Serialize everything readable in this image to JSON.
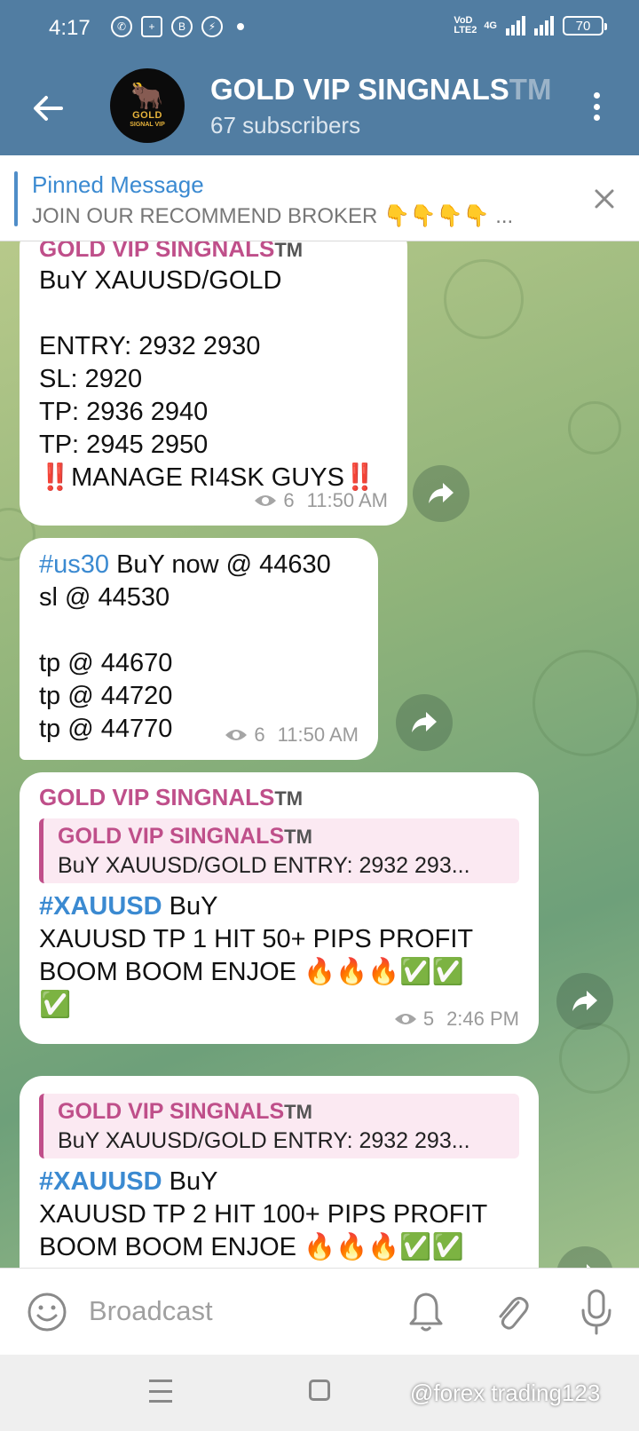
{
  "status": {
    "time": "4:17",
    "network": "VoD LTE2",
    "net_type": "4G",
    "battery": "70"
  },
  "header": {
    "title": "GOLD VIP SINGNALS",
    "title_tm": "TM",
    "subtitle": "67 subscribers",
    "avatar_text_1": "GOLD",
    "avatar_text_2": "SIGNAL VIP"
  },
  "pinned": {
    "title": "Pinned Message",
    "text": "JOIN OUR RECOMMEND BROKER 👇👇👇👇 ..."
  },
  "messages": [
    {
      "sender": "GOLD VIP SINGNALS",
      "sender_tm": "TM",
      "lines": [
        "BuY XAUUSD/GOLD",
        "",
        "ENTRY: 2932 2930",
        "SL: 2920",
        "TP: 2936 2940",
        "TP: 2945 2950",
        "‼️MANAGE RI4SK GUYS‼️"
      ],
      "views": "6",
      "time": "11:50 AM"
    },
    {
      "hashtag": "#us30",
      "first_line_rest": " BuY now @ 44630",
      "lines": [
        "sl @ 44530",
        "",
        "tp @ 44670",
        "tp @ 44720",
        "tp @ 44770"
      ],
      "views": "6",
      "time": "11:50 AM"
    },
    {
      "sender": "GOLD VIP SINGNALS",
      "sender_tm": "TM",
      "reply_sender": "GOLD VIP SINGNALS",
      "reply_sender_tm": "TM",
      "reply_text": "BuY XAUUSD/GOLD   ENTRY: 2932 293...",
      "hashtag": "#XAUUSD",
      "first_line_rest": " BuY",
      "lines": [
        "XAUUSD TP 1 HIT 50+ PIPS PROFIT",
        "BOOM BOOM ENJOE 🔥🔥🔥✅✅",
        "✅"
      ],
      "views": "5",
      "time": "2:46 PM"
    },
    {
      "reply_sender": "GOLD VIP SINGNALS",
      "reply_sender_tm": "TM",
      "reply_text": "BuY XAUUSD/GOLD   ENTRY: 2932 293...",
      "hashtag": "#XAUUSD",
      "first_line_rest": " BuY",
      "lines": [
        "XAUUSD TP 2 HIT 100+ PIPS PROFIT",
        "BOOM BOOM ENJOE 🔥🔥🔥✅✅"
      ]
    }
  ],
  "input": {
    "placeholder": "Broadcast"
  },
  "watermark": "@forex trading123"
}
